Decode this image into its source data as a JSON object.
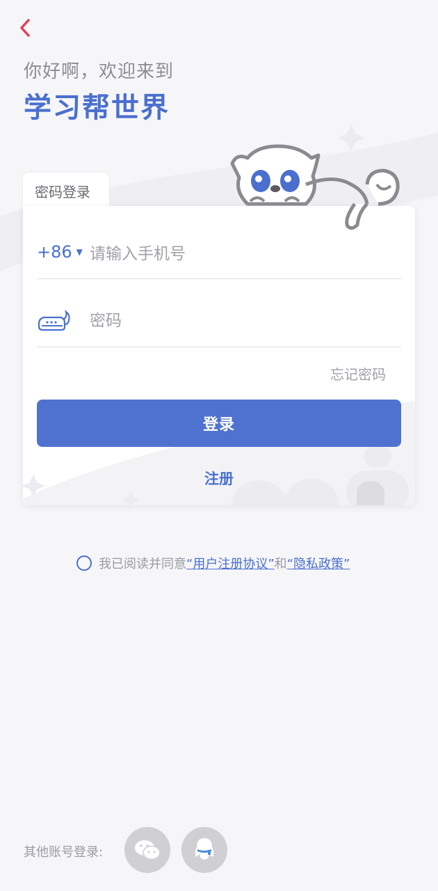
{
  "header": {
    "greeting": "你好啊，欢迎来到",
    "title": "学习帮世界"
  },
  "login_card": {
    "tab_label": "密码登录",
    "country_code": "+86",
    "phone_placeholder": "请输入手机号",
    "password_placeholder": "密码",
    "forgot_label": "忘记密码",
    "login_label": "登录",
    "register_label": "注册"
  },
  "agreement": {
    "prefix": "我已阅读并同意",
    "user_agreement": "“用户注册协议”",
    "conjunction": "和",
    "privacy_policy": "“隐私政策”"
  },
  "other_login": {
    "label": "其他账号登录:",
    "providers": [
      "wechat-icon",
      "qq-icon"
    ]
  },
  "colors": {
    "accent": "#4f72d0",
    "back_arrow": "#e0405a",
    "background": "#f6f6f9"
  }
}
